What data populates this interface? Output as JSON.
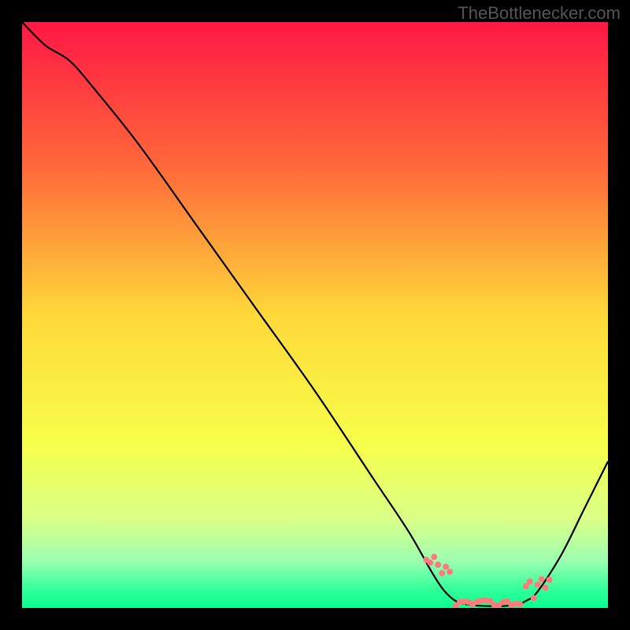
{
  "watermark": "TheBottlenecker.com",
  "chart_data": {
    "type": "line",
    "title": "",
    "xlabel": "",
    "ylabel": "",
    "xlim": [
      0,
      100
    ],
    "ylim": [
      0,
      100
    ],
    "gradient_stops": [
      {
        "pct": 0,
        "color": "#ff1745"
      },
      {
        "pct": 25,
        "color": "#ff6a3a"
      },
      {
        "pct": 50,
        "color": "#ffd83a"
      },
      {
        "pct": 72,
        "color": "#f6ff4a"
      },
      {
        "pct": 85,
        "color": "#d9ff88"
      },
      {
        "pct": 92,
        "color": "#9cffb0"
      },
      {
        "pct": 97,
        "color": "#2eff9a"
      },
      {
        "pct": 100,
        "color": "#0cff90"
      }
    ],
    "series": [
      {
        "name": "curve",
        "color": "#000000",
        "points": [
          {
            "x": 0,
            "y": 100
          },
          {
            "x": 4,
            "y": 96
          },
          {
            "x": 8,
            "y": 93.5
          },
          {
            "x": 12,
            "y": 89
          },
          {
            "x": 20,
            "y": 79
          },
          {
            "x": 30,
            "y": 65
          },
          {
            "x": 40,
            "y": 51
          },
          {
            "x": 50,
            "y": 37
          },
          {
            "x": 60,
            "y": 22
          },
          {
            "x": 66,
            "y": 13
          },
          {
            "x": 70,
            "y": 6
          },
          {
            "x": 72,
            "y": 3
          },
          {
            "x": 74,
            "y": 1.2
          },
          {
            "x": 76,
            "y": 0.6
          },
          {
            "x": 80,
            "y": 0.3
          },
          {
            "x": 84,
            "y": 0.5
          },
          {
            "x": 86,
            "y": 1.2
          },
          {
            "x": 88,
            "y": 2.8
          },
          {
            "x": 92,
            "y": 9
          },
          {
            "x": 96,
            "y": 17
          },
          {
            "x": 100,
            "y": 25
          }
        ]
      }
    ],
    "dot_regions": [
      {
        "name": "left-cluster",
        "color": "#ff7b7b",
        "x_range": [
          69,
          73
        ],
        "y_range": [
          2,
          9
        ],
        "count": 7
      },
      {
        "name": "bottom-span",
        "color": "#ff7b7b",
        "x_range": [
          74,
          85
        ],
        "y_range": [
          0.3,
          1.3
        ],
        "count": 16
      },
      {
        "name": "right-cluster",
        "color": "#ff7b7b",
        "x_range": [
          86,
          90
        ],
        "y_range": [
          1.5,
          6
        ],
        "count": 7
      }
    ],
    "dot_radius": 4
  }
}
